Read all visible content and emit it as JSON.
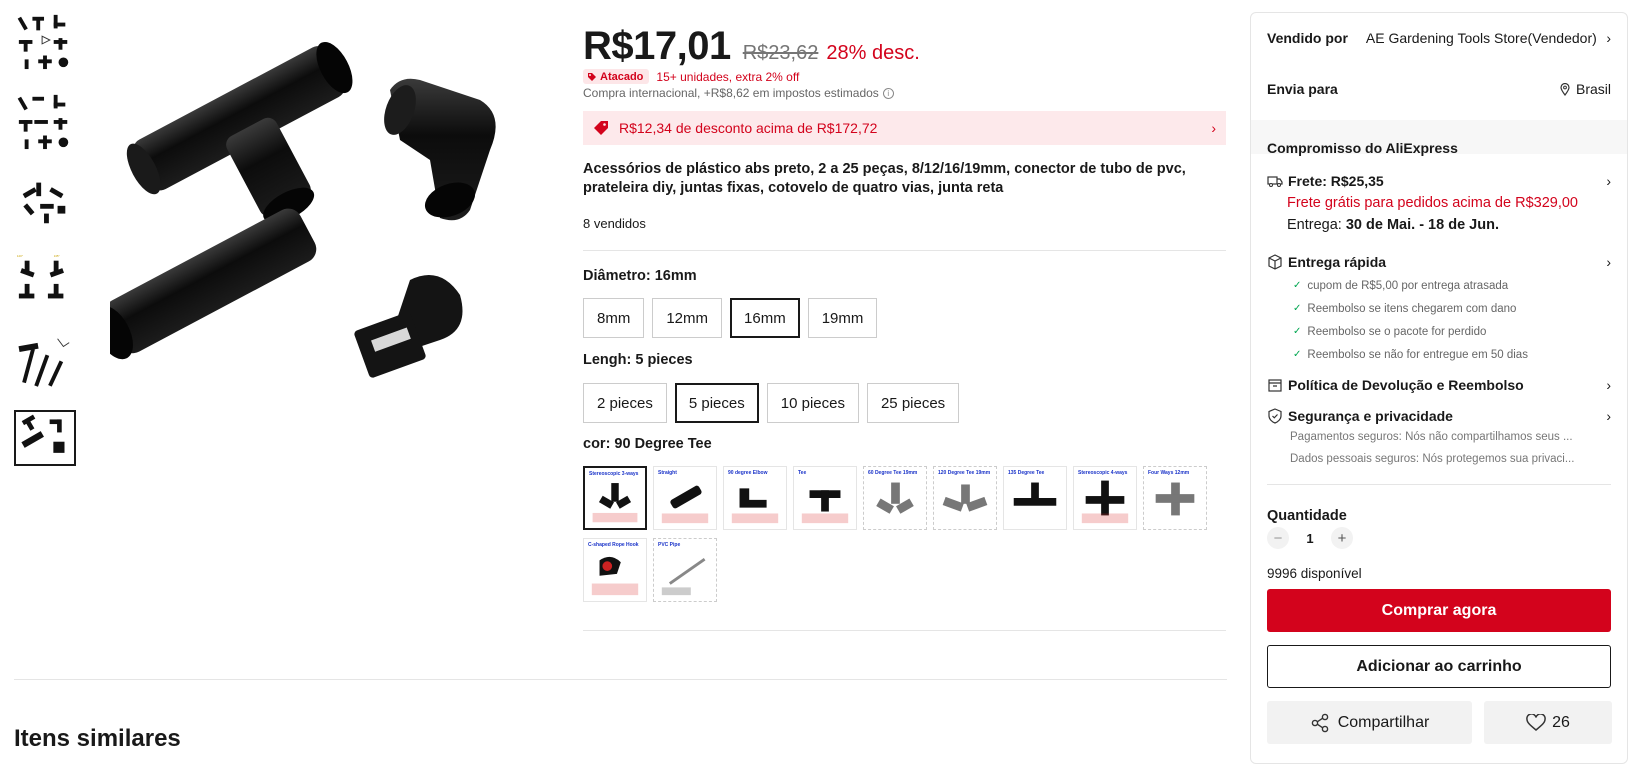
{
  "price": {
    "current": "R$17,01",
    "original": "R$23,62",
    "discount": "28% desc.",
    "wholesale_badge": "Atacado",
    "wholesale_text": "15+ unidades, extra 2% off",
    "import_note": "Compra internacional, +R$8,62 em impostos estimados"
  },
  "coupon": {
    "text": "R$12,34 de desconto acima de R$172,72"
  },
  "product": {
    "title": "Acessórios de plástico abs preto, 2 a 25 peças, 8/12/16/19mm, conector de tubo de pvc, prateleira diy, juntas fixas, cotovelo de quatro vias, junta reta",
    "sold": "8 vendidos"
  },
  "sku": {
    "diameter_label": "Diâmetro: 16mm",
    "diameter_options": [
      "8mm",
      "12mm",
      "16mm",
      "19mm"
    ],
    "length_label": "Lengh: 5 pieces",
    "length_options": [
      "2 pieces",
      "5 pieces",
      "10 pieces",
      "25 pieces"
    ],
    "color_label": "cor: 90 Degree Tee",
    "color_swatch_titles": [
      "Stereoscopic 3-ways",
      "Straight",
      "90 degree Elbow",
      "Tee",
      "60 Degree Tee 19mm",
      "120 Degree Tee 19mm",
      "135 Degree Tee",
      "Stereoscopic 4-ways",
      "Four Ways 12mm",
      "C-shaped Rope Hook",
      "PVC Pipe"
    ]
  },
  "similar": {
    "title": "Itens similares"
  },
  "sidebar": {
    "sold_by_label": "Vendido por",
    "seller": "AE Gardening Tools Store(Vendedor)",
    "ship_to_label": "Envia para",
    "ship_to": "Brasil",
    "commitment": "Compromisso do AliExpress",
    "shipping_title": "Frete: R$25,35",
    "free_shipping": "Frete grátis para pedidos acima de R$329,00",
    "delivery_label": "Entrega:",
    "delivery_dates": "30 de Mai. - 18 de Jun.",
    "fast_delivery": "Entrega rápida",
    "fast_bullets": [
      "cupom de R$5,00 por entrega atrasada",
      "Reembolso se itens chegarem com dano",
      "Reembolso se o pacote for perdido",
      "Reembolso se não for entregue em 50 dias"
    ],
    "return_policy": "Política de Devolução e Reembolso",
    "security": "Segurança e privacidade",
    "security_lines": [
      "Pagamentos seguros: Nós não compartilhamos seus ...",
      "Dados pessoais seguros: Nós protegemos sua privaci..."
    ],
    "quantity_label": "Quantidade",
    "quantity": "1",
    "available": "9996 disponível",
    "buy_now": "Comprar agora",
    "add_to_cart": "Adicionar ao carrinho",
    "share": "Compartilhar",
    "wishlist_count": "26"
  },
  "colors": {
    "accent": "#d3031c",
    "coupon_bg": "#fde9eb",
    "success": "#00a650"
  }
}
